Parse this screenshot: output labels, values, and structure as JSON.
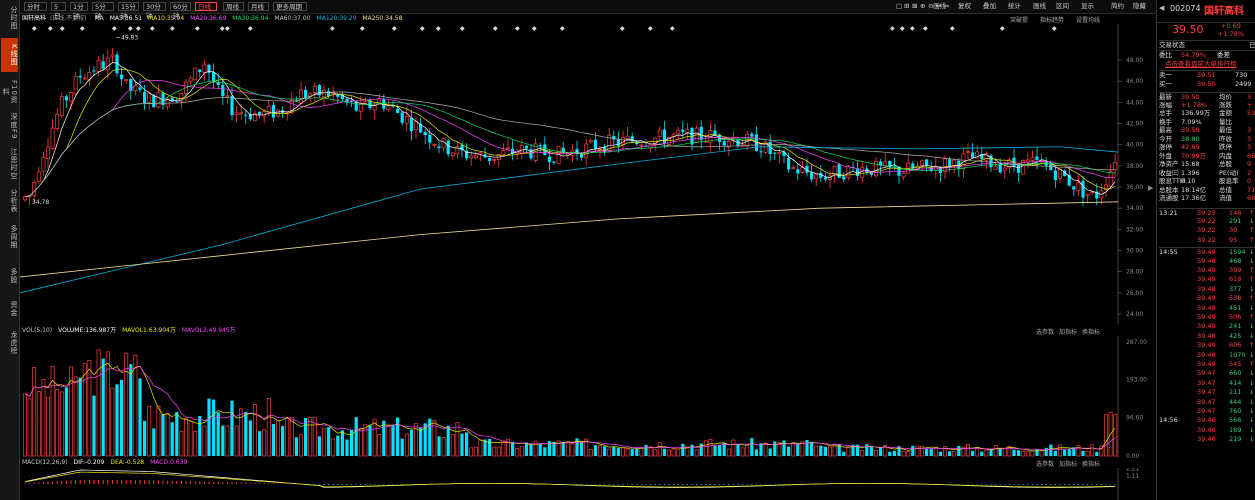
{
  "sidebar": {
    "items": [
      "分时图",
      "K线图",
      "F10资料",
      "深度F9",
      "江恩时空",
      "分析表",
      "多周期",
      "多股",
      "资金",
      "龙虎榜"
    ]
  },
  "toolbar": {
    "periods": [
      "分时",
      "5日",
      "1分钟",
      "5分钟",
      "15分钟",
      "30分钟",
      "60分钟",
      "日线",
      "周线",
      "月线",
      "更多周期"
    ],
    "right_buttons": [
      "画线",
      "复权",
      "叠加",
      "统计",
      "画线",
      "区间",
      "显示",
      "简约",
      "隐藏"
    ],
    "right_icon_labels": [
      "窗口",
      "叠加"
    ]
  },
  "main_legend": {
    "stock": "国轩高科",
    "mode": "(日线,不复权)",
    "ma_items": [
      {
        "label": "MA",
        "value": "",
        "color": "#dddddd"
      },
      {
        "label": "MA5:",
        "value": "36.51",
        "color": "#ffffff"
      },
      {
        "label": "MA10:",
        "value": "35.94",
        "color": "#e8e800"
      },
      {
        "label": "MA20:",
        "value": "36.69",
        "color": "#ff40ff"
      },
      {
        "label": "MA30:",
        "value": "36.94",
        "color": "#00e060"
      },
      {
        "label": "MA60:",
        "value": "37.00",
        "color": "#c0c0c0"
      },
      {
        "label": "MA120:",
        "value": "39.29",
        "color": "#00b0e0"
      },
      {
        "label": "MA250:",
        "value": "34.58",
        "color": "#f0e090"
      }
    ],
    "right_links": [
      "突破提",
      "指标趋势",
      "设置均线"
    ]
  },
  "main_chart": {
    "y_ticks": [
      "48.00",
      "46.00",
      "44.00",
      "42.00",
      "40.00",
      "38.00",
      "36.00",
      "34.00",
      "32.00",
      "30.00",
      "28.00",
      "26.00",
      "24.00"
    ],
    "high_label": "49.83",
    "low_label": "34.78"
  },
  "volume": {
    "legend": [
      {
        "text": "VOL(5,10)",
        "color": "#c8c8c8"
      },
      {
        "text": "VOLUME:136.987万",
        "color": "#ffffff"
      },
      {
        "text": "MAVOL1:63.904万",
        "color": "#e8e800"
      },
      {
        "text": "MAVOL2:49.945万",
        "color": "#ff40ff"
      }
    ],
    "right_links": [
      "选参数",
      "加指标",
      "换指标"
    ],
    "y_ticks": [
      "287.00",
      "193.00",
      "96.60",
      "0.00"
    ]
  },
  "macd": {
    "legend": [
      {
        "text": "MACD(12,26,9)",
        "color": "#c8c8c8"
      },
      {
        "text": "DIF:-0.209",
        "color": "#ffffff"
      },
      {
        "text": "DEA:-0.528",
        "color": "#e8e800"
      },
      {
        "text": "MACD:0.639",
        "color": "#ff40ff"
      }
    ],
    "right_links": [
      "选参数",
      "加指标",
      "换指标"
    ],
    "y_ticks": [
      "2.21",
      "1.11"
    ]
  },
  "quote": {
    "code": "002074",
    "name": "国轩高科",
    "price": "39.50",
    "change": "+0.69",
    "change_pct": "+1.78%",
    "status_label": "交易状态",
    "status_value": "已",
    "weibi_label": "委比",
    "weibi_value": "54.79%",
    "weicha_label": "委差",
    "link": "点击查看盘前大单排行榜",
    "asks": [
      {
        "label": "卖一",
        "price": "39.51",
        "vol": "730"
      },
      {
        "label": "买一",
        "price": "39.50",
        "vol": "2499"
      }
    ],
    "stats": [
      {
        "l1": "最新",
        "v1": "39.50",
        "l2": "均价",
        "v2": "3",
        "c1": "red"
      },
      {
        "l1": "涨幅",
        "v1": "+1.78%",
        "l2": "涨跌",
        "v2": "+",
        "c1": "red"
      },
      {
        "l1": "总手",
        "v1": "136.99万",
        "l2": "金额",
        "v2": "53",
        "c1": "wht"
      },
      {
        "l1": "换手",
        "v1": "7.09%",
        "l2": "量比",
        "v2": "",
        "c1": "wht"
      },
      {
        "l1": "最高",
        "v1": "39.50",
        "l2": "最低",
        "v2": "3",
        "c1": "red"
      },
      {
        "l1": "今开",
        "v1": "38.80",
        "l2": "昨收",
        "v2": "3",
        "c1": "green"
      },
      {
        "l1": "涨停",
        "v1": "42.69",
        "l2": "跌停",
        "v2": "3",
        "c1": "red"
      },
      {
        "l1": "外盘",
        "v1": "70.99万",
        "l2": "内盘",
        "v2": "66",
        "c1": "red"
      },
      {
        "l1": "净资产",
        "v1": "15.68",
        "l2": "总股",
        "v2": "9",
        "c1": "wht"
      },
      {
        "l1": "收益㈢",
        "v1": "1.396",
        "l2": "PE(动)",
        "v2": "2",
        "c1": "wht"
      },
      {
        "l1": "股息TTM",
        "v1": "0.10",
        "l2": "股息率",
        "v2": "0",
        "c1": "wht"
      },
      {
        "l1": "总股本",
        "v1": "18.14亿",
        "l2": "总值",
        "v2": "716",
        "c1": "wht"
      },
      {
        "l1": "流通股",
        "v1": "17.36亿",
        "l2": "流值",
        "v2": "685",
        "c1": "wht"
      }
    ],
    "ticks": [
      {
        "time": "13:21",
        "price": "39.23",
        "vol": "148",
        "c": "red"
      },
      {
        "time": "",
        "price": "39.22",
        "vol": "291",
        "c": "green"
      },
      {
        "time": "",
        "price": "39.22",
        "vol": "30",
        "c": "red"
      },
      {
        "time": "",
        "price": "39.22",
        "vol": "95",
        "c": "red"
      },
      {
        "time": "14:55",
        "price": "39.49",
        "vol": "1594",
        "c": "green"
      },
      {
        "time": "",
        "price": "39.48",
        "vol": "468",
        "c": "green"
      },
      {
        "time": "",
        "price": "39.49",
        "vol": "399",
        "c": "red"
      },
      {
        "time": "",
        "price": "39.49",
        "vol": "618",
        "c": "red"
      },
      {
        "time": "",
        "price": "39.48",
        "vol": "377",
        "c": "green"
      },
      {
        "time": "",
        "price": "39.49",
        "vol": "538",
        "c": "red"
      },
      {
        "time": "",
        "price": "39.48",
        "vol": "451",
        "c": "green"
      },
      {
        "time": "",
        "price": "39.49",
        "vol": "506",
        "c": "red"
      },
      {
        "time": "",
        "price": "39.49",
        "vol": "241",
        "c": "green"
      },
      {
        "time": "",
        "price": "39.48",
        "vol": "425",
        "c": "green"
      },
      {
        "time": "",
        "price": "39.49",
        "vol": "606",
        "c": "red"
      },
      {
        "time": "",
        "price": "39.48",
        "vol": "1070",
        "c": "green"
      },
      {
        "time": "",
        "price": "39.49",
        "vol": "545",
        "c": "red"
      },
      {
        "time": "",
        "price": "39.47",
        "vol": "660",
        "c": "green"
      },
      {
        "time": "",
        "price": "39.47",
        "vol": "414",
        "c": "green"
      },
      {
        "time": "",
        "price": "39.47",
        "vol": "211",
        "c": "green"
      },
      {
        "time": "",
        "price": "39.47",
        "vol": "444",
        "c": "green"
      },
      {
        "time": "",
        "price": "39.47",
        "vol": "760",
        "c": "green"
      },
      {
        "time": "14:56",
        "price": "39.46",
        "vol": "566",
        "c": "green"
      },
      {
        "time": "",
        "price": "39.46",
        "vol": "189",
        "c": "green"
      },
      {
        "time": "",
        "price": "39.46",
        "vol": "219",
        "c": "green"
      }
    ]
  }
}
